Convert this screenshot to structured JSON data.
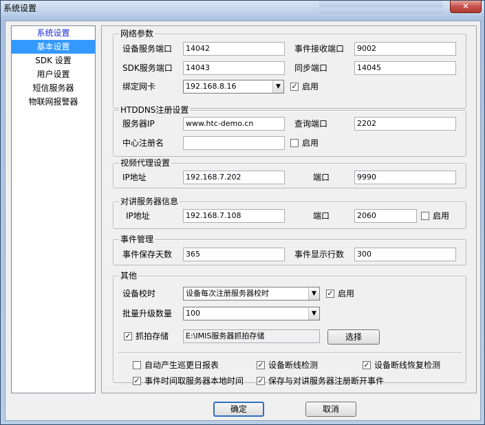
{
  "window": {
    "title": "系统设置",
    "close_glyph": "✕"
  },
  "nav": {
    "items": [
      {
        "label": "系统设置"
      },
      {
        "label": "基本设置"
      },
      {
        "label": "SDK 设置"
      },
      {
        "label": "用户设置"
      },
      {
        "label": "短信服务器"
      },
      {
        "label": "物联网报警器"
      }
    ]
  },
  "network": {
    "legend": "网络参数",
    "device_port_label": "设备服务端口",
    "device_port_value": "14042",
    "event_port_label": "事件接收端口",
    "event_port_value": "9002",
    "sdk_port_label": "SDK服务端口",
    "sdk_port_value": "14043",
    "sync_port_label": "同步端口",
    "sync_port_value": "14045",
    "nic_label": "绑定网卡",
    "nic_value": "192.168.8.16",
    "enable_label": "启用",
    "enable_checked": "✓"
  },
  "htddns": {
    "legend": "HTDDNS注册设置",
    "server_ip_label": "服务器IP",
    "server_ip_value": "www.htc-demo.cn",
    "query_port_label": "查询端口",
    "query_port_value": "2202",
    "center_name_label": "中心注册名",
    "center_name_value": "",
    "enable_label": "启用",
    "enable_checked": ""
  },
  "video_proxy": {
    "legend": "视频代理设置",
    "ip_label": "IP地址",
    "ip_value": "192.168.7.202",
    "port_label": "端口",
    "port_value": "9990"
  },
  "intercom": {
    "legend": "对讲服务器信息",
    "ip_label": "IP地址",
    "ip_value": "192.168.7.108",
    "port_label": "端口",
    "port_value": "2060",
    "enable_label": "启用",
    "enable_checked": ""
  },
  "events": {
    "legend": "事件管理",
    "save_days_label": "事件保存天数",
    "save_days_value": "365",
    "rows_label": "事件显示行数",
    "rows_value": "300"
  },
  "other": {
    "legend": "其他",
    "time_sync_label": "设备校时",
    "time_sync_value": "设备每次注册服务器校时",
    "time_sync_enable_label": "启用",
    "time_sync_enable_checked": "✓",
    "batch_label": "批量升级数量",
    "batch_value": "100",
    "capture_label": "抓拍存储",
    "capture_checked": "✓",
    "capture_path": "E:\\IMIS服务器抓拍存储",
    "choose_button": "选择"
  },
  "options": {
    "auto_report_label": "自动产生巡更日报表",
    "auto_report_checked": "",
    "disconnect_detect_label": "设备断线检测",
    "disconnect_detect_checked": "✓",
    "reconnect_detect_label": "设备断线恢复检测",
    "reconnect_detect_checked": "✓",
    "local_time_label": "事件时间取服务器本地时间",
    "local_time_checked": "✓",
    "intercom_event_label": "保存与对讲服务器注册断开事件",
    "intercom_event_checked": "✓"
  },
  "footer": {
    "ok_button": "确定",
    "cancel_button": "取消"
  }
}
